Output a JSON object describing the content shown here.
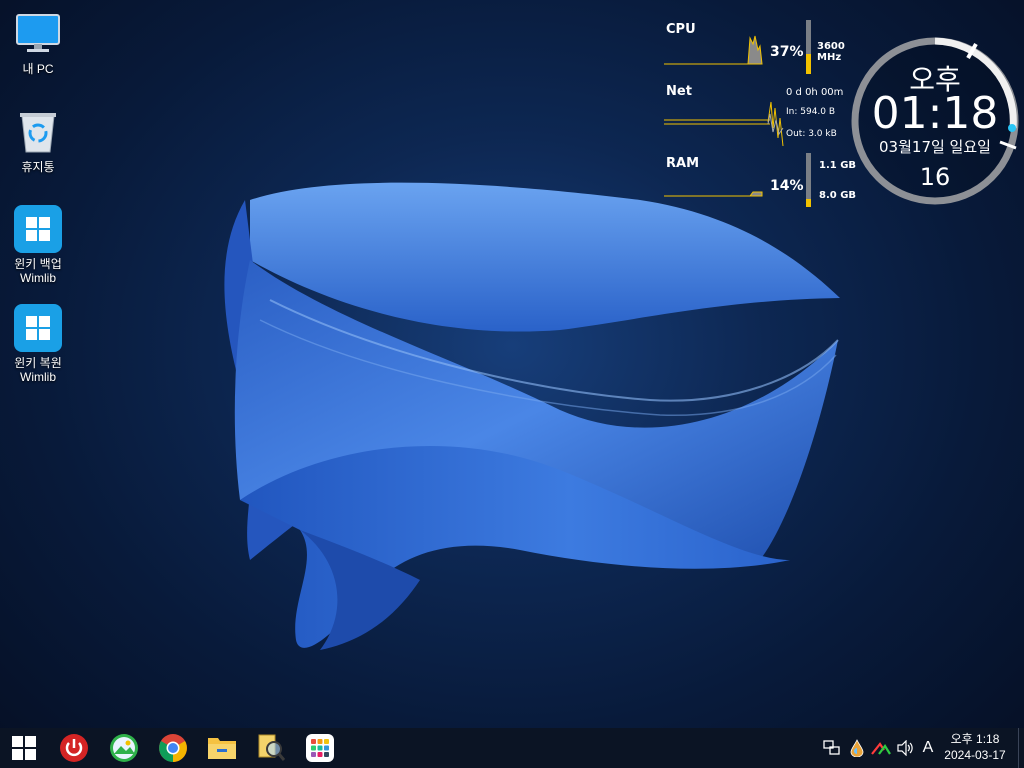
{
  "desktop": {
    "icons": [
      {
        "label": "내 PC",
        "icon": "monitor-icon"
      },
      {
        "label": "휴지통",
        "icon": "recycle-bin-icon"
      },
      {
        "label": "윈키 백업",
        "label2": "Wimlib",
        "icon": "windows-logo-icon"
      },
      {
        "label": "윈키 복원",
        "label2": "Wimlib",
        "icon": "windows-logo-icon"
      }
    ]
  },
  "widgets": {
    "cpu": {
      "title": "CPU",
      "percent": "37%",
      "freq": "3600 MHz",
      "level": 0.37
    },
    "net": {
      "title": "Net",
      "uptime": "0 d 0h 00m",
      "in": "In: 594.0 B",
      "out": "Out: 3.0 kB"
    },
    "ram": {
      "title": "RAM",
      "percent": "14%",
      "used": "1.1 GB",
      "total": "8.0 GB",
      "level": 0.14
    }
  },
  "clock_widget": {
    "ampm": "오후",
    "time": "01:18",
    "date": "03월17일 일요일",
    "seconds": "16"
  },
  "taskbar": {
    "apps": [
      {
        "name": "start-button",
        "icon": "windows-logo-icon"
      },
      {
        "name": "power-button",
        "icon": "power-icon"
      },
      {
        "name": "image-viewer-button",
        "icon": "photo-icon"
      },
      {
        "name": "chrome-button",
        "icon": "chrome-icon"
      },
      {
        "name": "file-explorer-button",
        "icon": "folder-icon"
      },
      {
        "name": "search-tool-button",
        "icon": "magnifier-icon"
      },
      {
        "name": "app-launcher-button",
        "icon": "app-grid-icon"
      }
    ],
    "tray": {
      "ime": "A",
      "time": "오후 1:18",
      "date": "2024-03-17"
    }
  },
  "colors": {
    "accent_yellow": "#f2c200",
    "wallpaper_blue": "#2f6fd6",
    "taskbar_bg": "#0b1424"
  }
}
